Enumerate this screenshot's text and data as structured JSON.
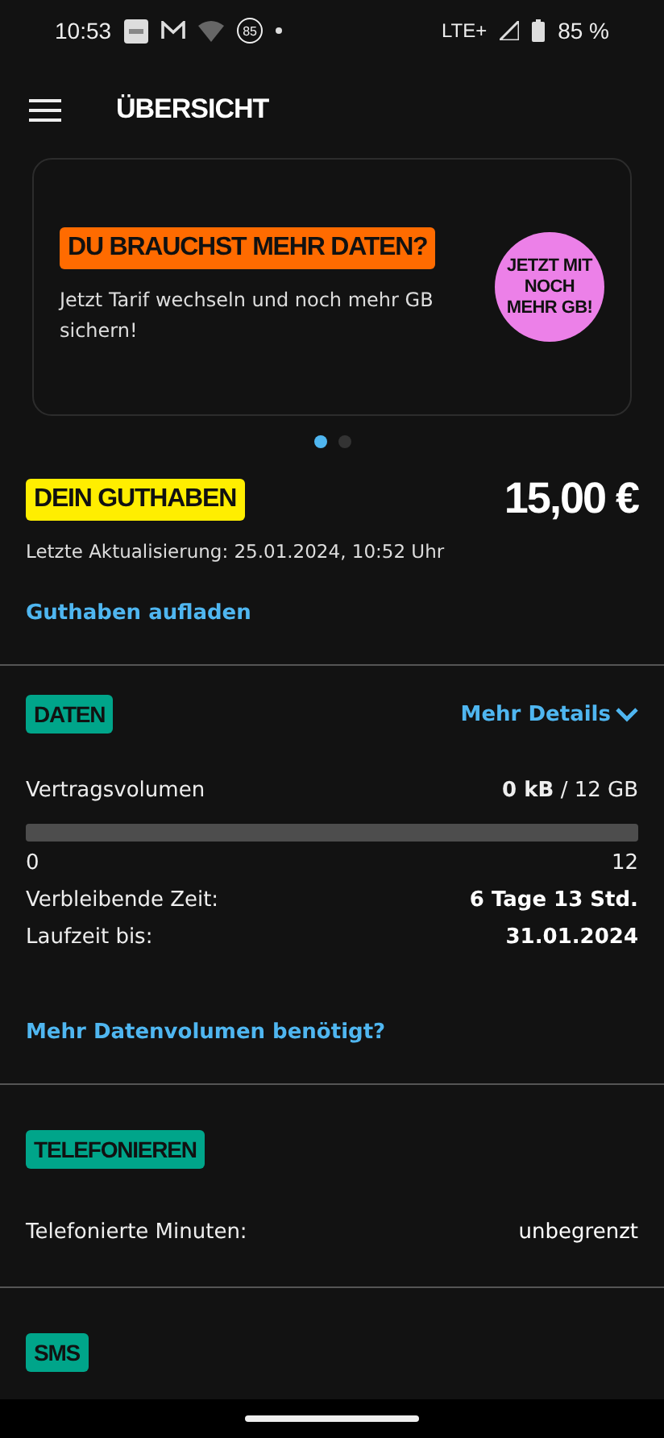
{
  "status_bar": {
    "time": "10:53",
    "badge": "85",
    "network": "LTE+",
    "battery": "85 %"
  },
  "header": {
    "title": "ÜBERSICHT"
  },
  "promo": {
    "headline": "DU BRAUCHST MEHR DATEN?",
    "text": "Jetzt Tarif wechseln und noch mehr GB sichern!",
    "sticker": "JETZT MIT NOCH MEHR GB!",
    "pages": [
      {
        "selected": true
      },
      {
        "selected": false
      }
    ]
  },
  "balance": {
    "label": "DEIN GUTHABEN",
    "amount": "15,00 €",
    "updated": "Letzte Aktualisierung: 25.01.2024, 10:52 Uhr",
    "link": "Guthaben aufladen"
  },
  "sections": [
    {
      "kind": "data",
      "tag": "DATEN",
      "details": "Mehr Details",
      "volume": {
        "label": "Vertragsvolumen",
        "used": "0 kB",
        "total": "/ 12 GB",
        "min": "0",
        "max": "12"
      },
      "rows": [
        {
          "label": "Verbleibende Zeit:",
          "value": "6 Tage 13 Std.",
          "bold": true
        },
        {
          "label": "Laufzeit bis:",
          "value": "31.01.2024",
          "bold": true
        }
      ],
      "link": "Mehr Datenvolumen benötigt?"
    },
    {
      "kind": "calls",
      "tag": "TELEFONIEREN",
      "rows": [
        {
          "label": "Telefonierte Minuten:",
          "value": "unbegrenzt",
          "bold": false
        }
      ]
    },
    {
      "kind": "sms",
      "tag": "SMS"
    }
  ]
}
